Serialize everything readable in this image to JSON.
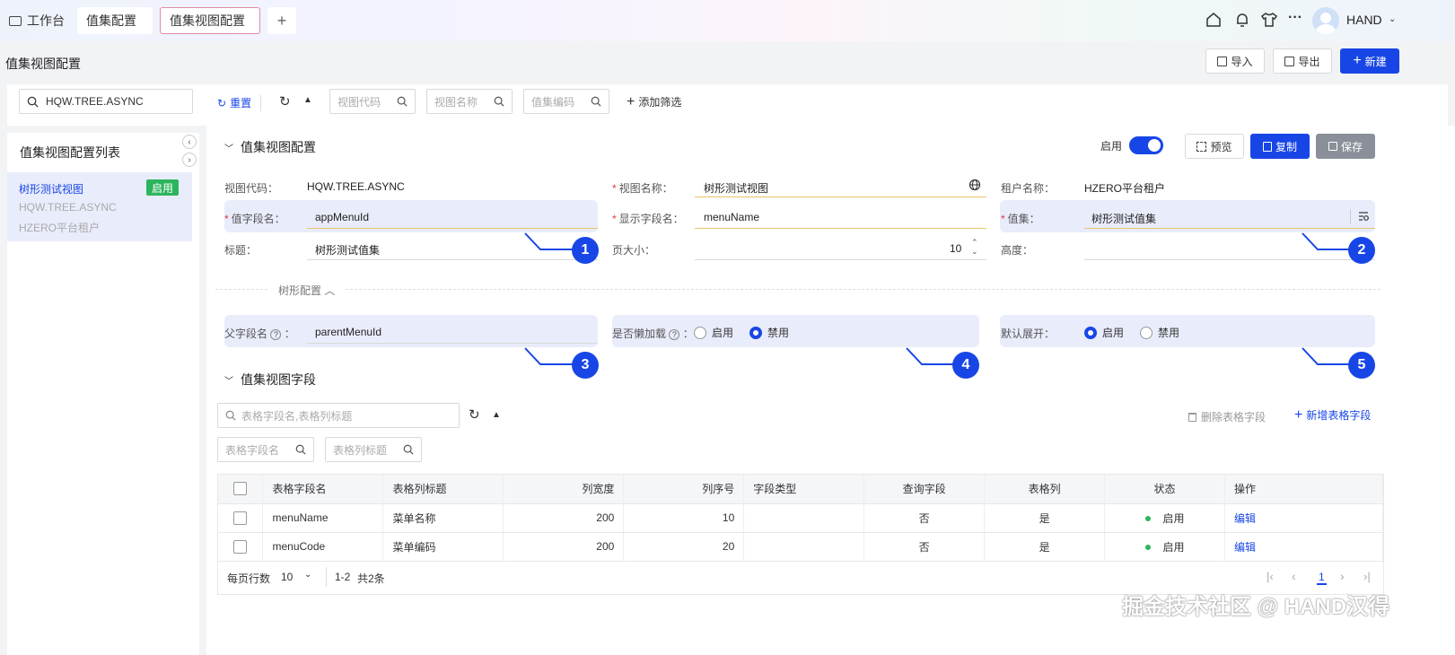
{
  "tabs": {
    "workbench": "工作台",
    "valueset": "值集配置",
    "viewconfig": "值集视图配置",
    "add": "+"
  },
  "header": {
    "user": "HAND",
    "page_title": "值集视图配置",
    "import_label": "导入",
    "export_label": "导出",
    "new_label": "新建"
  },
  "filter": {
    "search_value": "HQW.TREE.ASYNC",
    "reset_label": "重置",
    "view_code_ph": "视图代码",
    "view_name_ph": "视图名称",
    "valueset_code_ph": "值集编码",
    "add_filter_label": "添加筛选"
  },
  "left": {
    "title": "值集视图配置列表",
    "item": {
      "name": "树形测试视图",
      "status": "启用",
      "code": "HQW.TREE.ASYNC",
      "tenant": "HZERO平台租户"
    }
  },
  "form": {
    "section_title": "值集视图配置",
    "enable_label": "启用",
    "preview_label": "预览",
    "copy_label": "复制",
    "save_label": "保存",
    "view_code_label": "视图代码：",
    "view_code_value": "HQW.TREE.ASYNC",
    "view_name_label": "视图名称：",
    "view_name_value": "树形测试视图",
    "tenant_label": "租户名称：",
    "tenant_value": "HZERO平台租户",
    "value_field_label": "值字段名：",
    "value_field_value": "appMenuId",
    "display_field_label": "显示字段名：",
    "display_field_value": "menuName",
    "valueset_label": "值集：",
    "valueset_value": "树形测试值集",
    "title_label": "标题：",
    "title_value": "树形测试值集",
    "page_size_label": "页大小：",
    "page_size_value": "10",
    "height_label": "高度：",
    "tree_config_label": "树形配置",
    "parent_field_label": "父字段名",
    "parent_field_value": "parentMenuId",
    "lazy_label": "是否懒加载",
    "default_expand_label": "默认展开：",
    "opt_enable": "启用",
    "opt_disable": "禁用",
    "badges": [
      "1",
      "2",
      "3",
      "4",
      "5"
    ]
  },
  "fields": {
    "section_title": "值集视图字段",
    "search_ph": "表格字段名,表格列标题",
    "delete_label": "删除表格字段",
    "add_label": "新增表格字段",
    "field_name_ph": "表格字段名",
    "col_title_ph": "表格列标题",
    "columns": [
      "表格字段名",
      "表格列标题",
      "列宽度",
      "列序号",
      "字段类型",
      "查询字段",
      "表格列",
      "状态",
      "操作"
    ],
    "rows": [
      {
        "field": "menuName",
        "title": "菜单名称",
        "width": "200",
        "order": "10",
        "type": "",
        "query": "否",
        "col": "是",
        "status": "启用",
        "action": "编辑"
      },
      {
        "field": "menuCode",
        "title": "菜单编码",
        "width": "200",
        "order": "20",
        "type": "",
        "query": "否",
        "col": "是",
        "status": "启用",
        "action": "编辑"
      }
    ],
    "page_size_label": "每页行数",
    "page_size_value": "10",
    "range_text": "1-2",
    "total_text": "共2条",
    "current_page": "1"
  },
  "watermark": "掘金技术社区 @ HAND汉得"
}
